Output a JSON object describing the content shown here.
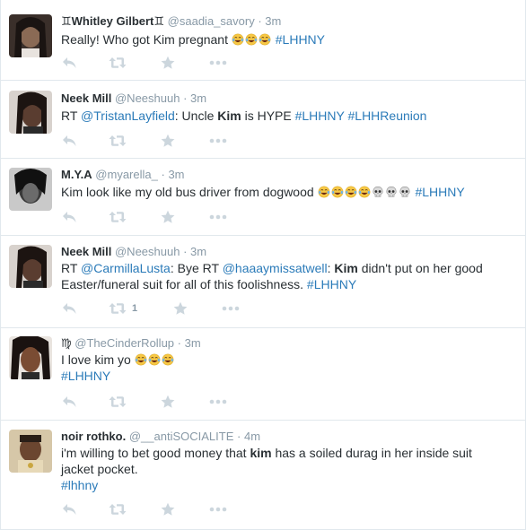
{
  "colors": {
    "link": "#2b7bb9",
    "meta": "#8899a6",
    "action_icon": "#ccd6dd",
    "divider": "#e1e8ed"
  },
  "tweets": [
    {
      "fullname": "♊Whitley Gilbert♊",
      "username": "@saadia_savory",
      "time": "3m",
      "parts": [
        "Really! Who got Kim pregnant "
      ],
      "emojis": [
        "laugh-cry",
        "laugh-cry",
        "laugh-cry"
      ],
      "hashtag": "#LHHNY",
      "retweet_count": ""
    },
    {
      "fullname": "Neek Mill",
      "username": "@Neeshuuh",
      "time": "3m",
      "rt_prefix": "RT ",
      "mention": "@TristanLayfield",
      "after_mention": ": Uncle ",
      "bold": "Kim",
      "after_bold": " is HYPE ",
      "hashtag": "#LHHNY",
      "hashtag2": "#LHHReunion",
      "retweet_count": ""
    },
    {
      "fullname": "M.Y.A",
      "username": "@myarella_",
      "time": "3m",
      "parts": [
        "Kim look like my old bus driver from dogwood "
      ],
      "emojis": [
        "laugh-cry",
        "laugh-cry",
        "laugh-cry",
        "laugh-cry",
        "skull",
        "skull",
        "skull"
      ],
      "hashtag": "#LHHNY",
      "retweet_count": ""
    },
    {
      "fullname": "Neek Mill",
      "username": "@Neeshuuh",
      "time": "3m",
      "rt_prefix": "RT ",
      "mention": "@CarmillaLusta",
      "after_mention": ": Bye RT ",
      "mention2": "@haaaymissatwell",
      "after_mention2": ": ",
      "bold": "Kim",
      "line1_rest": " didn't put on her good",
      "line2": "Easter/funeral suit for all of this foolishness. ",
      "hashtag": "#LHHNY",
      "retweet_count": "1"
    },
    {
      "fullname": "♍",
      "username": "@TheCinderRollup",
      "time": "3m",
      "parts": [
        "I love kim yo "
      ],
      "emojis": [
        "laugh-cry",
        "laugh-cry",
        "laugh-cry"
      ],
      "hashtag": "#LHHNY",
      "retweet_count": ""
    },
    {
      "fullname": "noir rothko.",
      "username": "@__antiSOCIALITE",
      "time": "4m",
      "line1_pre": "i'm willing to bet good money that ",
      "bold": "kim",
      "line1_post": " has a soiled durag in her inside suit",
      "line2": "jacket pocket.",
      "hashtag": "#lhhny",
      "retweet_count": ""
    }
  ],
  "sep": "·"
}
